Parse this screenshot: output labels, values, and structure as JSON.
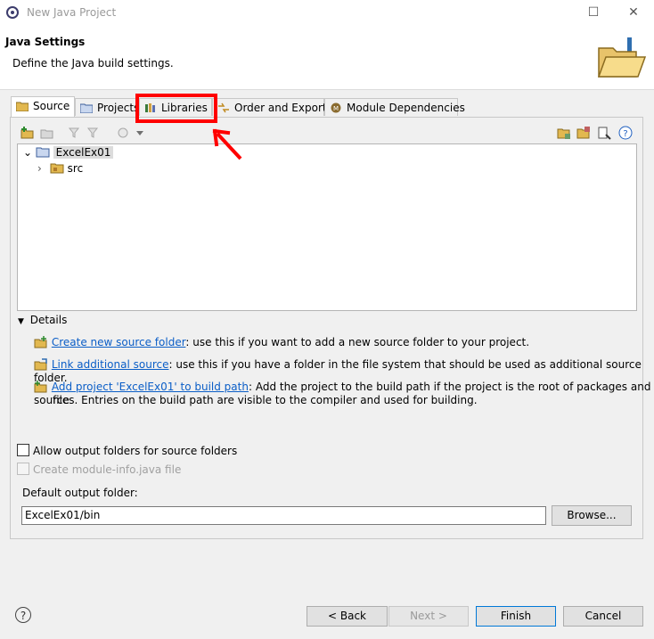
{
  "window": {
    "title": "New Java Project",
    "minimize_glyph": "☐",
    "close_glyph": "✕"
  },
  "header": {
    "title": "Java Settings",
    "description": "Define the Java build settings."
  },
  "tabs": [
    {
      "label": "Source",
      "icon": "source-folder-icon",
      "active": true
    },
    {
      "label": "Projects",
      "icon": "projects-icon"
    },
    {
      "label": "Libraries",
      "icon": "libraries-icon"
    },
    {
      "label": "Order and Export",
      "icon": "order-export-icon"
    },
    {
      "label": "Module Dependencies",
      "icon": "module-icon"
    }
  ],
  "tree": {
    "project": "ExcelEx01",
    "child": "src"
  },
  "details": {
    "toggle_label": "Details",
    "rows": [
      {
        "link": "Create new source folder",
        "text": ": use this if you want to add a new source folder to your project."
      },
      {
        "link": "Link additional source",
        "text": ": use this if you have a folder in the file system that should be used as additional source folder."
      },
      {
        "link": "Add project 'ExcelEx01' to build path",
        "text": ": Add the project to the build path if the project is the root of packages and source",
        "text2": "files. Entries on the build path are visible to the compiler and used for building."
      }
    ]
  },
  "options": {
    "allow_output": "Allow output folders for source folders",
    "module_info": "Create module-info.java file",
    "output_label": "Default output folder:",
    "output_value": "ExcelEx01/bin",
    "browse": "Browse..."
  },
  "footer": {
    "back": "< Back",
    "next": "Next >",
    "finish": "Finish",
    "cancel": "Cancel",
    "help_glyph": "?"
  },
  "colors": {
    "link": "#0b5ec7",
    "highlight": "#ff0000"
  }
}
